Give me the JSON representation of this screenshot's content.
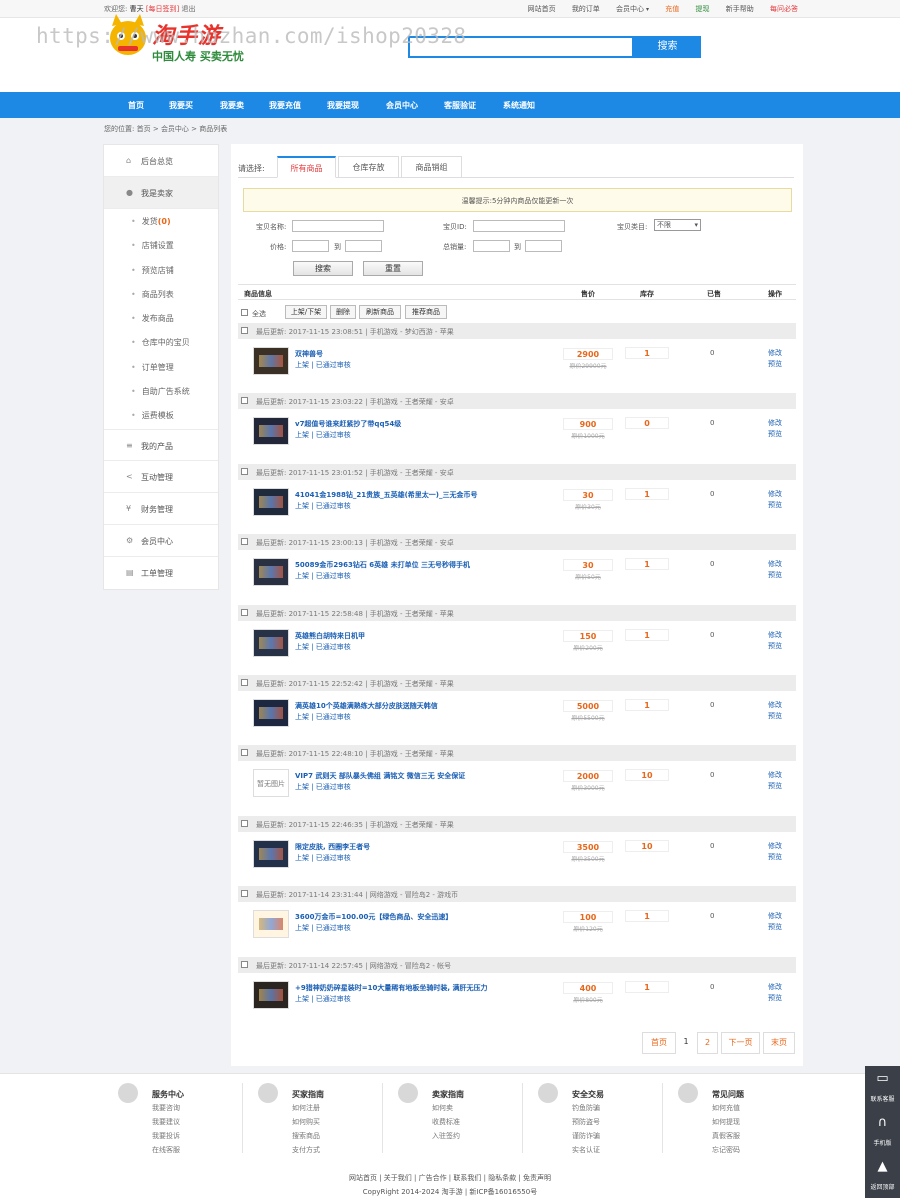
{
  "topbar": {
    "welcome": "欢迎您:",
    "user": "曹天",
    "checkin": "[每日签到]",
    "logout": "退出",
    "links": [
      "网站首页",
      "我的订单",
      "会员中心",
      "充值",
      "提现",
      "新手帮助",
      "每问必答"
    ]
  },
  "header": {
    "logo_text": "淘手游",
    "logo_sub": "中国人寿 买卖无忧",
    "watermark": "https://www.huzhan.com/ishop20328",
    "search_button": "搜索"
  },
  "nav": [
    "首页",
    "我要买",
    "我要卖",
    "我要充值",
    "我要提现",
    "会员中心",
    "客服验证",
    "系统通知"
  ],
  "breadcrumb": {
    "prefix": "您的位置:",
    "items": [
      "首页",
      "会员中心",
      "商品列表"
    ],
    "sep": ">"
  },
  "sidebar": {
    "top": [
      {
        "label": "后台总览",
        "icon": "home-icon"
      },
      {
        "label": "我是卖家",
        "icon": "user-icon"
      }
    ],
    "sub": [
      "发货",
      "店铺设置",
      "预览店铺",
      "商品列表",
      "发布商品",
      "仓库中的宝贝",
      "订单管理",
      "自助广告系统",
      "运费模板"
    ],
    "ship_count": "(0)",
    "bottom": [
      {
        "label": "我的产品",
        "icon": "list-icon"
      },
      {
        "label": "互动管理",
        "icon": "share-icon"
      },
      {
        "label": "财务管理",
        "icon": "yen-icon"
      },
      {
        "label": "会员中心",
        "icon": "gears-icon"
      },
      {
        "label": "工单管理",
        "icon": "clipboard-icon"
      }
    ]
  },
  "tabs": {
    "label": "请选择:",
    "items": [
      "所有商品",
      "仓库存放",
      "商品销组"
    ]
  },
  "notice": "温馨提示:5分钟内商品仅能更新一次",
  "filters": {
    "name_label": "宝贝名称:",
    "id_label": "宝贝ID:",
    "category_label": "宝贝类目:",
    "category_value": "不限",
    "price_label": "价格:",
    "to": "到",
    "sales_label": "总销量:",
    "search": "搜索",
    "reset": "重置"
  },
  "table": {
    "headers": [
      "商品信息",
      "售价",
      "库存",
      "已售",
      "操作"
    ],
    "select_all": "全选",
    "actions": [
      "上架/下架",
      "删除",
      "刷新商品",
      "推荐商品"
    ]
  },
  "products": [
    {
      "meta": "最后更新: 2017-11-15 23:08:51 | 手机游戏 - 梦幻西游 - 苹果",
      "title": "双神兽号",
      "price": "2900",
      "orig": "原价29900元",
      "stock": "1",
      "sold": "0",
      "img": true
    },
    {
      "meta": "最后更新: 2017-11-15 23:03:22 | 手机游戏 - 王者荣耀 - 安卓",
      "title": "v7超值号谁来赶紧抄了带qq54级",
      "price": "900",
      "orig": "原价1000元",
      "stock": "0",
      "sold": "0",
      "img": true
    },
    {
      "meta": "最后更新: 2017-11-15 23:01:52 | 手机游戏 - 王者荣耀 - 安卓",
      "title": "41041金1988钻_21贵族_五英雄(希里太一)_三无金币号",
      "price": "30",
      "orig": "原价30元",
      "stock": "1",
      "sold": "0",
      "img": true
    },
    {
      "meta": "最后更新: 2017-11-15 23:00:13 | 手机游戏 - 王者荣耀 - 安卓",
      "title": "50089金币2963钻石 6英雄 未打单位 三无号秒得手机",
      "price": "30",
      "orig": "原价50元",
      "stock": "1",
      "sold": "0",
      "img": true
    },
    {
      "meta": "最后更新: 2017-11-15 22:58:48 | 手机游戏 - 王者荣耀 - 苹果",
      "title": "英雄熊白胡特来日机甲",
      "price": "150",
      "orig": "原价200元",
      "stock": "1",
      "sold": "0",
      "img": true
    },
    {
      "meta": "最后更新: 2017-11-15 22:52:42 | 手机游戏 - 王者荣耀 - 苹果",
      "title": "满英雄10个英雄满熟练大部分皮肤送随天韩信",
      "price": "5000",
      "orig": "原价5500元",
      "stock": "1",
      "sold": "0",
      "img": true
    },
    {
      "meta": "最后更新: 2017-11-15 22:48:10 | 手机游戏 - 王者荣耀 - 苹果",
      "title": "VIP7 武则天 部队暴头佛组 满铭文 微信三无 安全保证",
      "price": "2000",
      "orig": "原价3000元",
      "stock": "10",
      "sold": "0",
      "img": false
    },
    {
      "meta": "最后更新: 2017-11-15 22:46:35 | 手机游戏 - 王者荣耀 - 苹果",
      "title": "限定皮肤, 西圈李王者号",
      "price": "3500",
      "orig": "原价3500元",
      "stock": "10",
      "sold": "0",
      "img": true
    },
    {
      "meta": "最后更新: 2017-11-14 23:31:44 | 网络游戏 - 冒险岛2 - 游戏币",
      "title": "3600万金币=100.00元【绿色商品、安全迅速】",
      "price": "100",
      "orig": "原价120元",
      "stock": "1",
      "sold": "0",
      "img": true
    },
    {
      "meta": "最后更新: 2017-11-14 22:57:45 | 网络游戏 - 冒险岛2 - 帐号",
      "title": "+9猎神奶奶碎星装时=10大量稀有地板坐骑时装, 满肝无压力",
      "price": "400",
      "orig": "原价800元",
      "stock": "1",
      "sold": "0",
      "img": true
    }
  ],
  "row_status": "上架 | 已通过审核",
  "row_ops": [
    "修改",
    "预览"
  ],
  "no_image": "暂无图片",
  "pager": [
    "首页",
    "1",
    "2",
    "下一页",
    "末页"
  ],
  "footer": {
    "cols": [
      {
        "title": "服务中心",
        "links": [
          "我要咨询",
          "我要建议",
          "我要投诉",
          "在线客服"
        ]
      },
      {
        "title": "买家指南",
        "links": [
          "如何注册",
          "如何购买",
          "搜索商品",
          "支付方式"
        ]
      },
      {
        "title": "卖家指南",
        "links": [
          "如何卖",
          "收费标准",
          "入驻签约"
        ]
      },
      {
        "title": "安全交易",
        "links": [
          "钓鱼防骗",
          "预防盗号",
          "谨防诈骗",
          "实名认证"
        ]
      },
      {
        "title": "常见问题",
        "links": [
          "如何充值",
          "如何提现",
          "真假客服",
          "忘记密码"
        ]
      }
    ],
    "links": "网站首页 | 关于我们 | 广告合作 | 联系我们 | 隐私条款 | 免责声明",
    "copyright": "CopyRight 2014-2024 淘手游 | 新ICP备16016550号"
  },
  "float": [
    "联系客服",
    "手机版",
    "返回顶部"
  ]
}
